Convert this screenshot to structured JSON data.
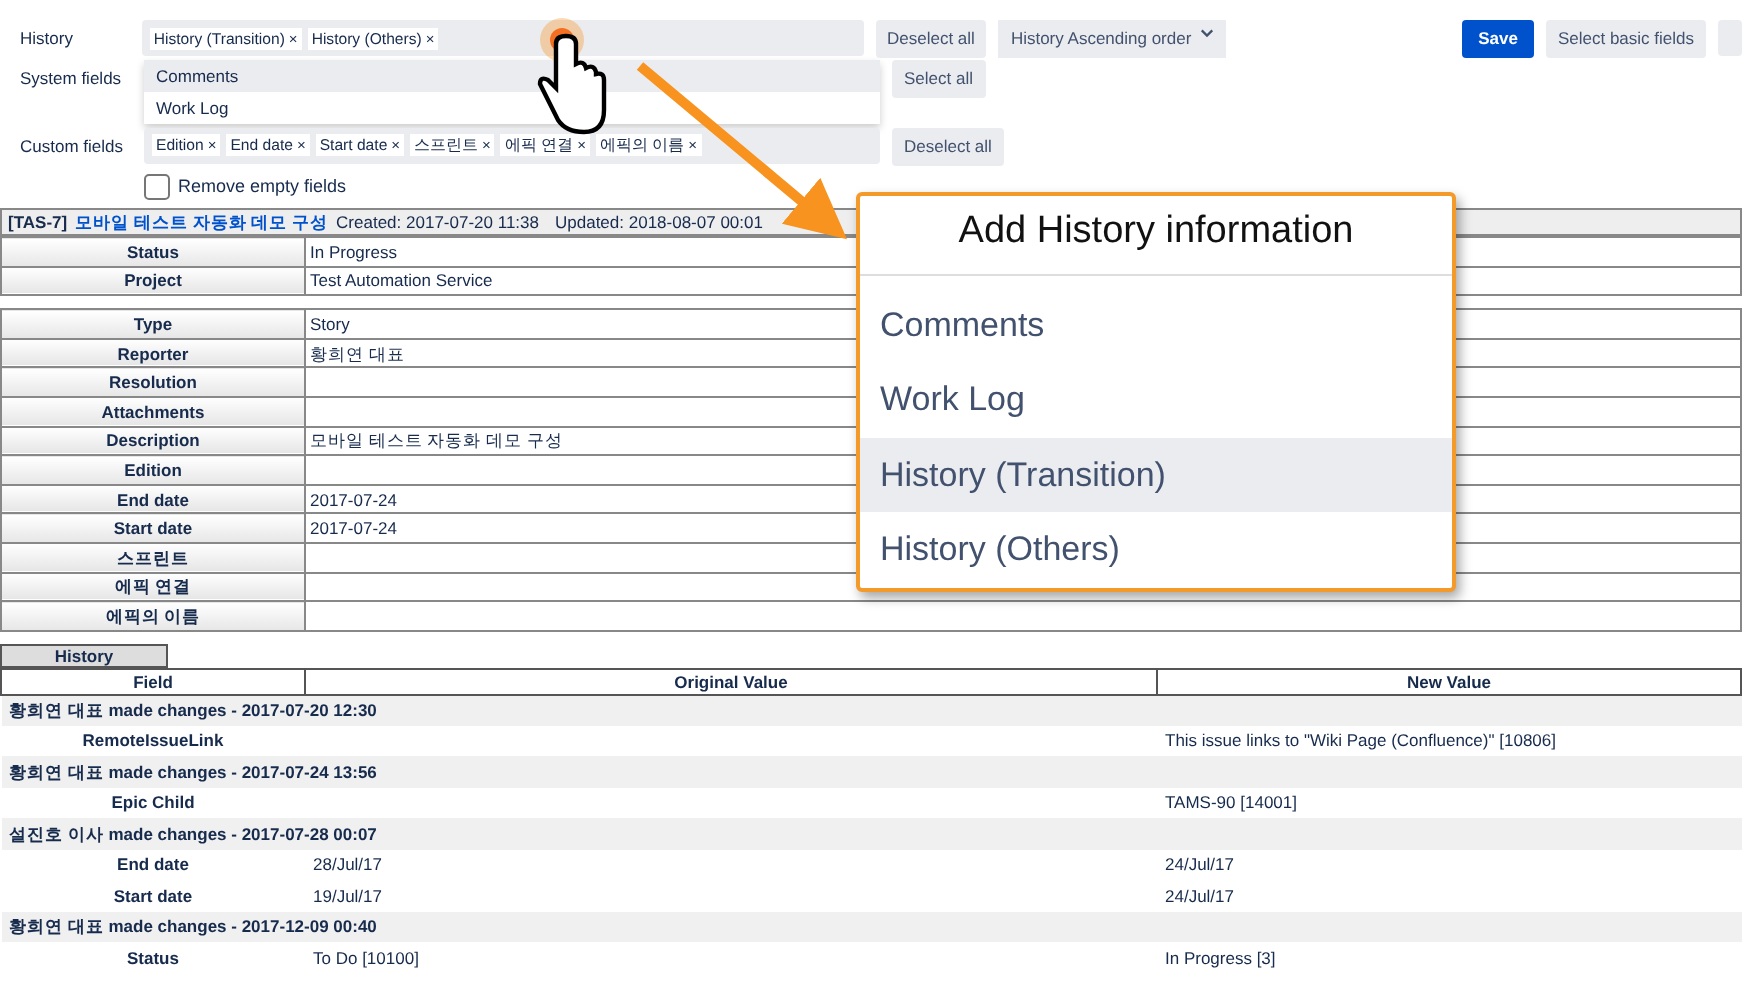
{
  "form": {
    "history": {
      "label": "History",
      "tags": [
        {
          "label": "History (Transition)",
          "remove": "×"
        },
        {
          "label": "History (Others)",
          "remove": "×"
        }
      ],
      "button": "Deselect all",
      "dropdown": [
        {
          "label": "Comments",
          "highlighted": true
        },
        {
          "label": "Work Log",
          "highlighted": false
        }
      ]
    },
    "system_fields": {
      "label": "System fields",
      "button": "Select all"
    },
    "custom_fields": {
      "label": "Custom fields",
      "tags": [
        {
          "label": "Edition",
          "remove": "×"
        },
        {
          "label": "End date",
          "remove": "×"
        },
        {
          "label": "Start date",
          "remove": "×"
        },
        {
          "label": "스프린트",
          "remove": "×"
        },
        {
          "label": "에픽 연결",
          "remove": "×"
        },
        {
          "label": "에픽의 이름",
          "remove": "×"
        }
      ],
      "button": "Deselect all"
    },
    "order_select": "History Ascending order",
    "save": "Save",
    "select_basic": "Select basic fields",
    "remove_empty": {
      "label": "Remove empty fields",
      "checked": false
    }
  },
  "issue": {
    "key": "[TAS-7]",
    "summary": "모바일 테스트 자동화 데모 구성",
    "created": "Created: 2017-07-20 11:38",
    "updated": "Updated: 2018-08-07 00:01"
  },
  "field_tables": [
    [
      {
        "label": "Status",
        "value": "In Progress"
      },
      {
        "label": "Project",
        "value": "Test Automation Service"
      }
    ],
    [
      {
        "label": "Type",
        "value": "Story"
      },
      {
        "label": "Reporter",
        "value": "황희연 대표"
      },
      {
        "label": "Resolution"
      },
      {
        "label": "Attachments"
      },
      {
        "label": "Description",
        "value": "모바일 테스트 자동화 데모 구성"
      },
      {
        "label": "Edition"
      },
      {
        "label": "End date",
        "value": "2017-07-24"
      },
      {
        "label": "Start date",
        "value": "2017-07-24"
      },
      {
        "label": "스프린트"
      },
      {
        "label": "에픽 연결"
      },
      {
        "label": "에픽의 이름"
      }
    ]
  ],
  "history": {
    "title": "History",
    "columns": [
      "Field",
      "Original Value",
      "New Value"
    ],
    "groups": [
      {
        "header": "황희연 대표 made changes - 2017-07-20 12:30",
        "rows": [
          {
            "field": "RemoteIssueLink",
            "new": "This issue links to \"Wiki Page (Confluence)\" [10806]"
          }
        ]
      },
      {
        "header": "황희연 대표 made changes - 2017-07-24 13:56",
        "rows": [
          {
            "field": "Epic Child",
            "new": "TAMS-90 [14001]"
          }
        ]
      },
      {
        "header": "설진호 이사 made changes - 2017-07-28 00:07",
        "rows": [
          {
            "field": "End date",
            "original": "28/Jul/17",
            "new": "24/Jul/17"
          },
          {
            "field": "Start date",
            "original": "19/Jul/17",
            "new": "24/Jul/17"
          }
        ]
      },
      {
        "header": "황희연 대표 made changes - 2017-12-09 00:40",
        "rows": [
          {
            "field": "Status",
            "original": "To Do [10100]",
            "new": "In Progress [3]"
          }
        ]
      }
    ]
  },
  "callout": {
    "title": "Add History information",
    "items": [
      {
        "label": "Comments",
        "selected": false
      },
      {
        "label": "Work Log",
        "selected": false
      },
      {
        "label": "History (Transition)",
        "selected": true
      },
      {
        "label": "History (Others)",
        "selected": false
      }
    ]
  }
}
